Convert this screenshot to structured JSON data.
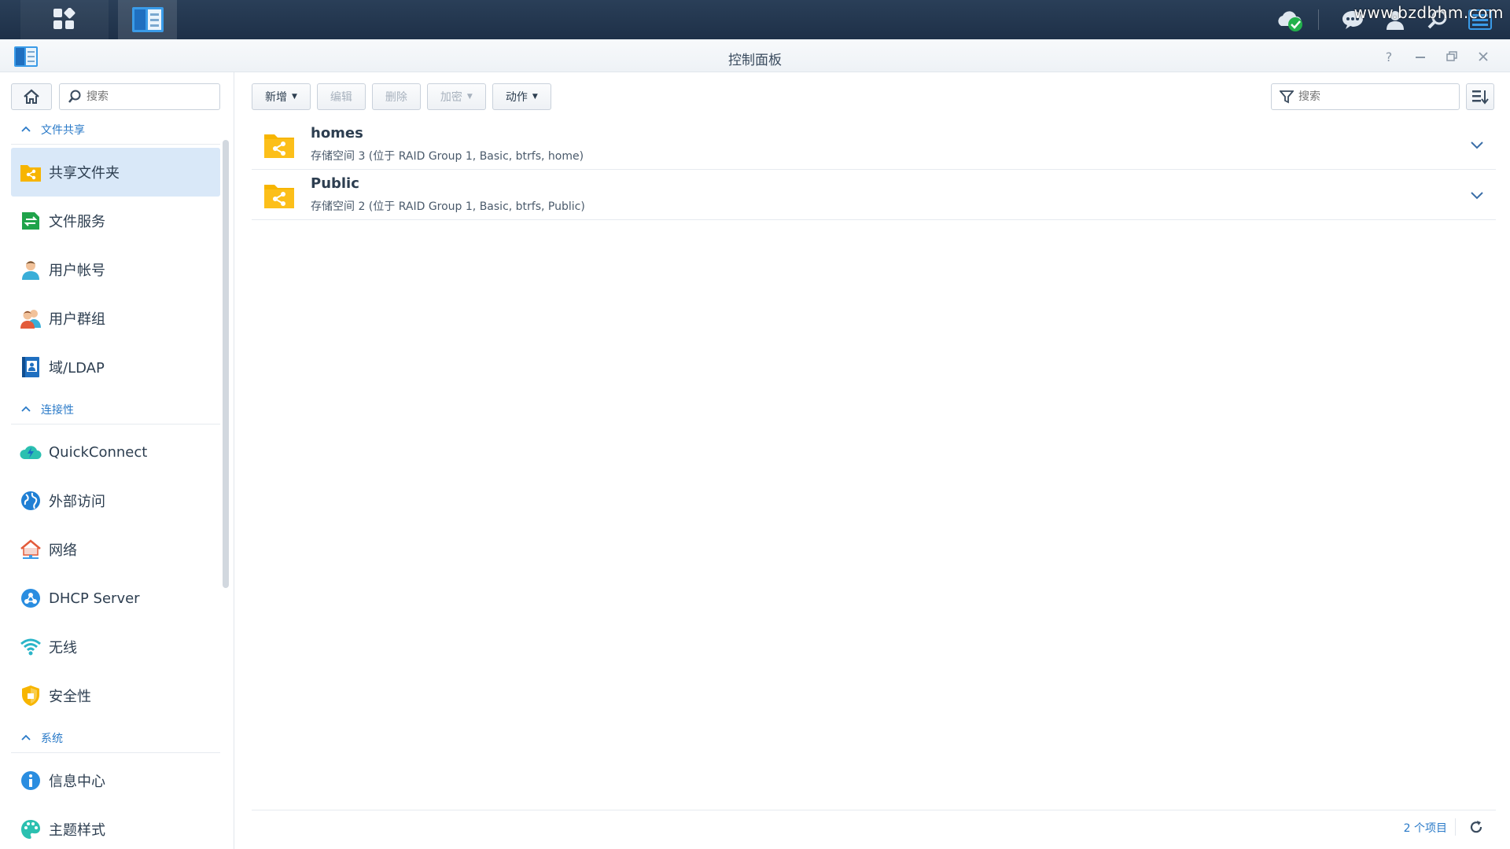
{
  "taskbar": {
    "watermark": "www.bzdbhm.com"
  },
  "window": {
    "title": "控制面板"
  },
  "sidebar": {
    "search_placeholder": "搜索",
    "sections": [
      {
        "label": "文件共享",
        "items": [
          {
            "label": "共享文件夹",
            "icon": "shared-folder-icon",
            "active": true
          },
          {
            "label": "文件服务",
            "icon": "file-services-icon"
          },
          {
            "label": "用户帐号",
            "icon": "user-icon"
          },
          {
            "label": "用户群组",
            "icon": "group-icon"
          },
          {
            "label": "域/LDAP",
            "icon": "ldap-icon"
          }
        ]
      },
      {
        "label": "连接性",
        "items": [
          {
            "label": "QuickConnect",
            "icon": "quickconnect-icon"
          },
          {
            "label": "外部访问",
            "icon": "external-access-icon"
          },
          {
            "label": "网络",
            "icon": "network-icon"
          },
          {
            "label": "DHCP Server",
            "icon": "dhcp-icon"
          },
          {
            "label": "无线",
            "icon": "wireless-icon"
          },
          {
            "label": "安全性",
            "icon": "security-shield-icon"
          }
        ]
      },
      {
        "label": "系统",
        "items": [
          {
            "label": "信息中心",
            "icon": "info-center-icon"
          },
          {
            "label": "主题样式",
            "icon": "theme-palette-icon"
          }
        ]
      }
    ]
  },
  "toolbar": {
    "create_label": "新增",
    "edit_label": "编辑",
    "delete_label": "删除",
    "encrypt_label": "加密",
    "action_label": "动作",
    "filter_placeholder": "搜索"
  },
  "shared_folders": [
    {
      "name": "homes",
      "description": "存储空间 3 (位于 RAID Group 1, Basic, btrfs, home)"
    },
    {
      "name": "Public",
      "description": "存储空间 2 (位于 RAID Group 1, Basic, btrfs, Public)"
    }
  ],
  "footer": {
    "item_count": "2 个项目"
  },
  "colors": {
    "accent": "#2a7ac8",
    "folder": "#f7b500",
    "active_bg": "#d9e8f8",
    "taskbar": "#1e3048"
  }
}
